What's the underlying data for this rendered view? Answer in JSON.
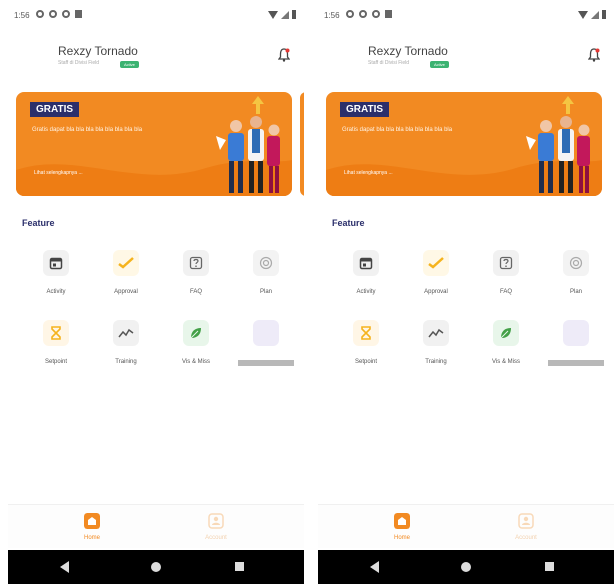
{
  "status": {
    "time": "1:56"
  },
  "user": {
    "name": "Rexzy Tornado",
    "subtitle": "Staff di Divisi Field",
    "badge": "Active"
  },
  "banner": {
    "tag": "GRATIS",
    "text": "Gratis dapat bla bla bla bla bla bla bla bla",
    "link": "Lihat selengkapnya ..."
  },
  "features": {
    "title": "Feature",
    "items": [
      {
        "label": "Activity",
        "icon": "calendar-icon",
        "bg": "#f1f1f1"
      },
      {
        "label": "Approval",
        "icon": "approval-check-icon",
        "bg": "#fff8e6"
      },
      {
        "label": "FAQ",
        "icon": "faq-icon",
        "bg": "#f1f1f1"
      },
      {
        "label": "Plan",
        "icon": "plan-target-icon",
        "bg": "#f3f3f3"
      },
      {
        "label": "Setpoint",
        "icon": "hourglass-icon",
        "bg": "#fff6e6"
      },
      {
        "label": "Training",
        "icon": "chart-line-icon",
        "bg": "#f1f1f1"
      },
      {
        "label": "Vis & Miss",
        "icon": "leaf-icon",
        "bg": "#e8f6ea"
      },
      {
        "label": "",
        "icon": "placeholder-icon",
        "bg": "#eeebf8"
      }
    ]
  },
  "nav": {
    "home_label": "Home",
    "account_label": "Account"
  },
  "colors": {
    "accent": "#f28a22",
    "navy": "#2b2f6b"
  }
}
